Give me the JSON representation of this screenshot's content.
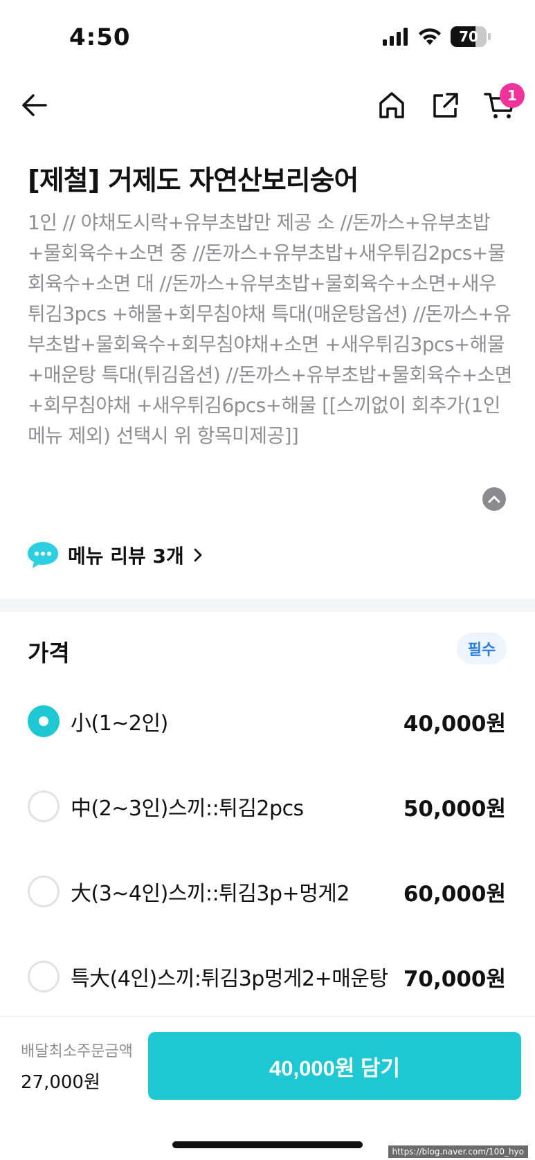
{
  "status_bar": {
    "time": "4:50",
    "battery": "70",
    "battery_level": 0.7
  },
  "nav": {
    "cart_count": "1",
    "icons": [
      "back-arrow-icon",
      "home-icon",
      "share-icon",
      "cart-icon"
    ]
  },
  "menu": {
    "title": "[제철] 거제도 자연산보리숭어",
    "description": "1인 // 야채도시락+유부초밥만 제공 소 //돈까스+유부초밥+물회육수+소면 중 //돈까스+유부초밥+새우튀김2pcs+물회육수+소면 대 //돈까스+유부초밥+물회육수+소면+새우튀김3pcs +해물+회무침야채 특대(매운탕옵션) //돈까스+유부초밥+물회육수+회무침야채+소면 +새우튀김3pcs+해물+매운탕 특대(튀김옵션) //돈까스+유부초밥+물회육수+소면+회무침야채 +새우튀김6pcs+해물 [[스끼없이 회추가(1인 메뉴 제외) 선택시 위 항목미제공]]",
    "review_link": "메뉴 리뷰 3개"
  },
  "price_section": {
    "title": "가격",
    "required_badge": "필수",
    "options": [
      {
        "label": "小(1~2인)",
        "price": "40,000원",
        "selected": true
      },
      {
        "label": "中(2~3인)스끼::튀김2pcs",
        "price": "50,000원",
        "selected": false
      },
      {
        "label": "大(3~4인)스끼::튀김3p+멍게2",
        "price": "60,000원",
        "selected": false
      },
      {
        "label": "특大(4인)스끼:튀김3p멍게2+매운탕",
        "price": "70,000원",
        "selected": false
      }
    ]
  },
  "bottom": {
    "min_order_label": "배달최소주문금액",
    "min_order_value": "27,000원",
    "add_button": "40,000원 담기",
    "watermark": "https://blog.naver.com/100_hyo"
  },
  "colors": {
    "accent": "#1ec8d3",
    "badge": "#f0339b",
    "required_text": "#2a7fe0",
    "muted_text": "#8e8e93"
  }
}
